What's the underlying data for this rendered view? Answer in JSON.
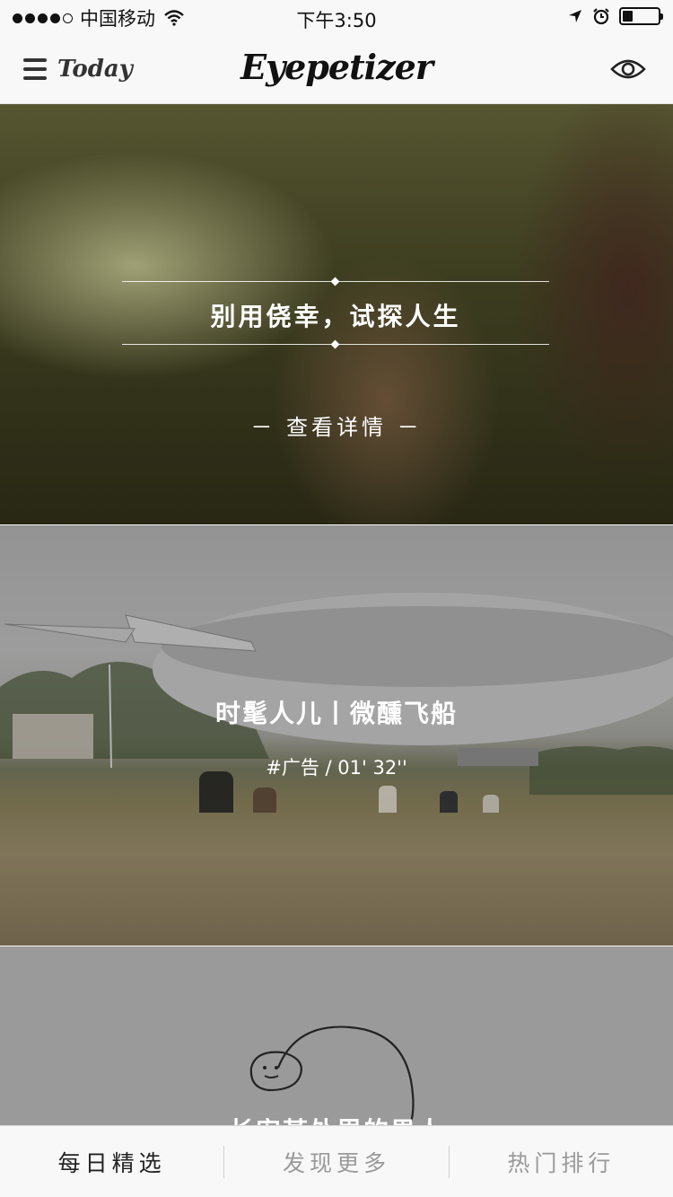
{
  "status_bar": {
    "carrier": "中国移动",
    "time": "下午3:50",
    "battery_level": 0.3
  },
  "nav": {
    "menu_label": "Today",
    "brand": "Eyepetizer",
    "icons": {
      "menu": "hamburger-icon",
      "eye": "eye-icon"
    }
  },
  "feed": [
    {
      "title": "别用侥幸，试探人生",
      "link": "－ 查看详情 －"
    },
    {
      "title": "时髦人儿丨微醺飞船",
      "meta": "#广告  /  01' 32''"
    },
    {
      "title": "长安某处里的男人"
    }
  ],
  "tabs": [
    {
      "label": "每日精选",
      "active": true
    },
    {
      "label": "发现更多",
      "active": false
    },
    {
      "label": "热门排行",
      "active": false
    }
  ]
}
